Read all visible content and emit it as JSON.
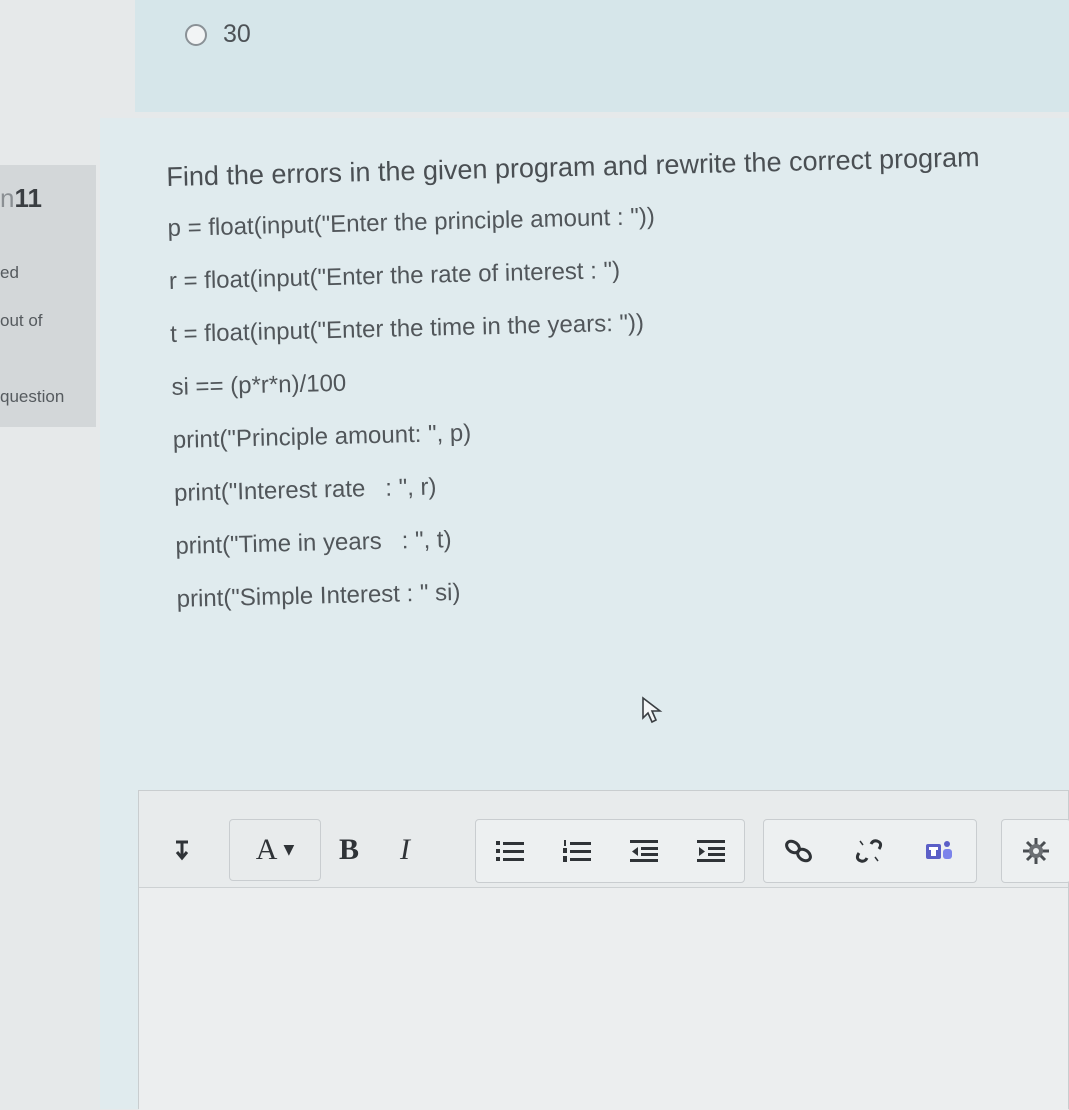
{
  "option": {
    "label": "30"
  },
  "question_info": {
    "number_prefix": "n",
    "number": "11",
    "status_fragment": "ed",
    "marks_fragment": "out of",
    "flag_fragment": "question"
  },
  "question": {
    "prompt": "Find the errors in the given program and rewrite the correct program",
    "code_lines": [
      "p = float(input(\"Enter the principle amount : \"))",
      "r = float(input(\"Enter the rate of interest : \")",
      "t = float(input(\"Enter the time in the years: \"))",
      "si == (p*r*n)/100",
      "print(\"Principle amount: \", p)",
      "print(\"Interest rate   : \", r)",
      "print(\"Time in years   : \", t)",
      "print(\"Simple Interest : \" si)"
    ]
  },
  "toolbar": {
    "bold_label": "B",
    "italic_label": "I",
    "font_color_label": "A",
    "icons": [
      "expand-toolbar-icon",
      "font-color-icon",
      "bold-icon",
      "italic-icon",
      "unordered-list-icon",
      "ordered-list-icon",
      "outdent-icon",
      "indent-icon",
      "link-icon",
      "unlink-icon",
      "teams-icon",
      "settings-icon"
    ]
  }
}
